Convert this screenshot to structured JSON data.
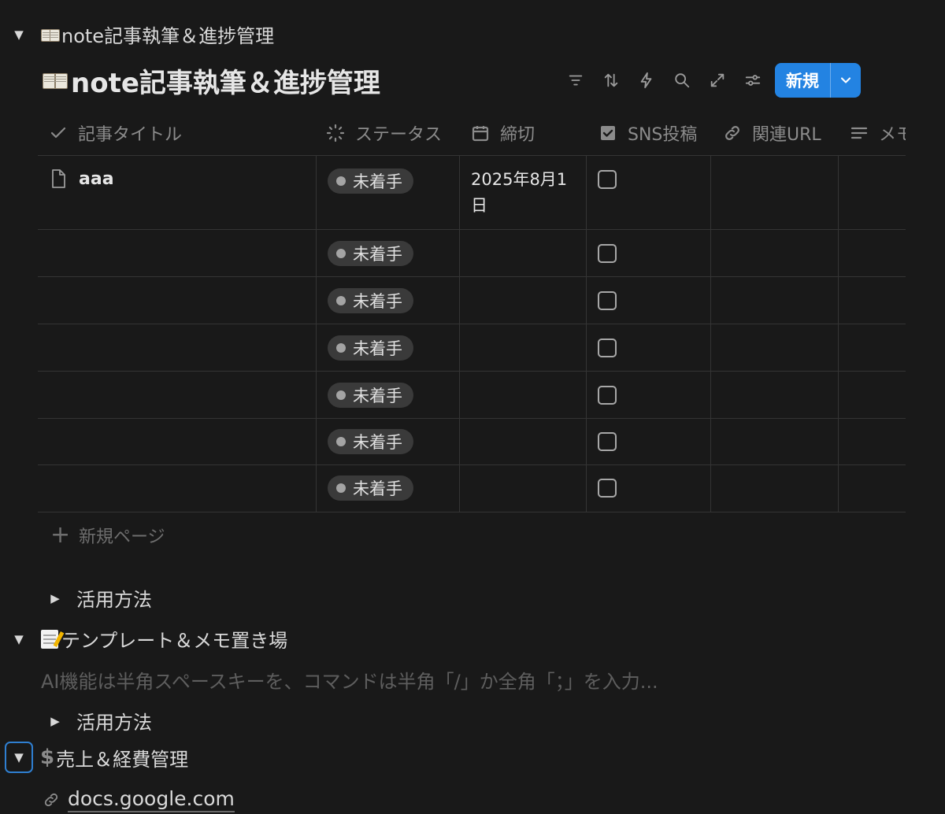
{
  "section1": {
    "toggle_icon": "triangle-down-icon",
    "emoji": "open-book-emoji-icon",
    "title": "note記事執筆＆進捗管理"
  },
  "database": {
    "title": "note記事執筆＆進捗管理",
    "toolbar_icons": [
      "filter-icon",
      "sort-icon",
      "automation-lightning-icon",
      "search-icon",
      "expand-icon",
      "settings-sliders-icon"
    ],
    "new_button_label": "新規",
    "columns": [
      {
        "label": "記事タイトル",
        "icon": "check-icon"
      },
      {
        "label": "ステータス",
        "icon": "status-spinner-icon"
      },
      {
        "label": "締切",
        "icon": "calendar-icon"
      },
      {
        "label": "SNS投稿",
        "icon": "checkbox-icon"
      },
      {
        "label": "関連URL",
        "icon": "link-icon"
      },
      {
        "label": "メモ",
        "icon": "text-lines-icon"
      }
    ],
    "rows": [
      {
        "title": "aaa",
        "status": "未着手",
        "deadline": "2025年8月1日",
        "sns_posted": false
      },
      {
        "title": "",
        "status": "未着手",
        "deadline": "",
        "sns_posted": false
      },
      {
        "title": "",
        "status": "未着手",
        "deadline": "",
        "sns_posted": false
      },
      {
        "title": "",
        "status": "未着手",
        "deadline": "",
        "sns_posted": false
      },
      {
        "title": "",
        "status": "未着手",
        "deadline": "",
        "sns_posted": false
      },
      {
        "title": "",
        "status": "未着手",
        "deadline": "",
        "sns_posted": false
      },
      {
        "title": "",
        "status": "未着手",
        "deadline": "",
        "sns_posted": false
      }
    ],
    "add_page_label": "新規ページ"
  },
  "usage_toggle_1": {
    "label": "活用方法"
  },
  "section2": {
    "emoji": "memo-emoji-icon",
    "title": "テンプレート＆メモ置き場"
  },
  "placeholder_text": "AI機能は半角スペースキーを、コマンドは半角「/」か全角「；」を入力...",
  "usage_toggle_2": {
    "label": "活用方法"
  },
  "section3": {
    "symbol": "$",
    "title": "売上＆経費管理"
  },
  "link": {
    "text": "docs.google.com",
    "icon": "link-icon"
  },
  "colors": {
    "background": "#191919",
    "accent": "#2383e2",
    "focus_ring": "#2f7fd1"
  }
}
